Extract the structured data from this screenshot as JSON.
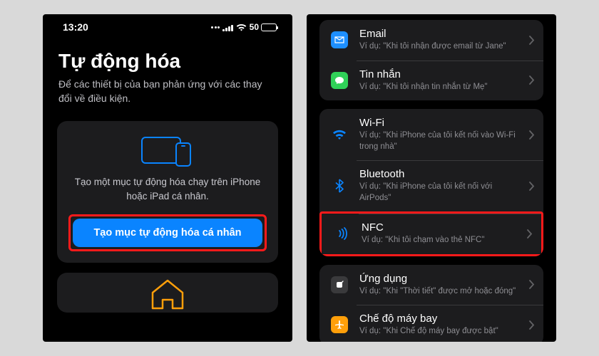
{
  "status": {
    "time": "13:20",
    "battery_pct": "50"
  },
  "left": {
    "title": "Tự động hóa",
    "subtitle": "Để các thiết bị của bạn phản ứng với các thay đổi về điều kiện.",
    "card_text": "Tạo một mục tự động hóa chạy trên iPhone hoặc iPad cá nhân.",
    "cta_label": "Tạo mục tự động hóa cá nhân"
  },
  "right": {
    "groups": [
      [
        {
          "title": "Email",
          "sub": "Ví dụ: \"Khi tôi nhận được email từ Jane\""
        },
        {
          "title": "Tin nhắn",
          "sub": "Ví dụ: \"Khi tôi nhận tin nhắn từ Mẹ\""
        }
      ],
      [
        {
          "title": "Wi-Fi",
          "sub": "Ví dụ: \"Khi iPhone của tôi kết nối vào Wi-Fi trong nhà\""
        },
        {
          "title": "Bluetooth",
          "sub": "Ví dụ: \"Khi iPhone của tôi kết nối với AirPods\""
        },
        {
          "title": "NFC",
          "sub": "Ví dụ: \"Khi tôi chạm vào thẻ NFC\""
        }
      ],
      [
        {
          "title": "Ứng dụng",
          "sub": "Ví dụ: \"Khi \"Thời tiết\" được mở hoặc đóng\""
        },
        {
          "title": "Chế độ máy bay",
          "sub": "Ví dụ: \"Khi Chế độ máy bay được bật\""
        }
      ]
    ]
  }
}
